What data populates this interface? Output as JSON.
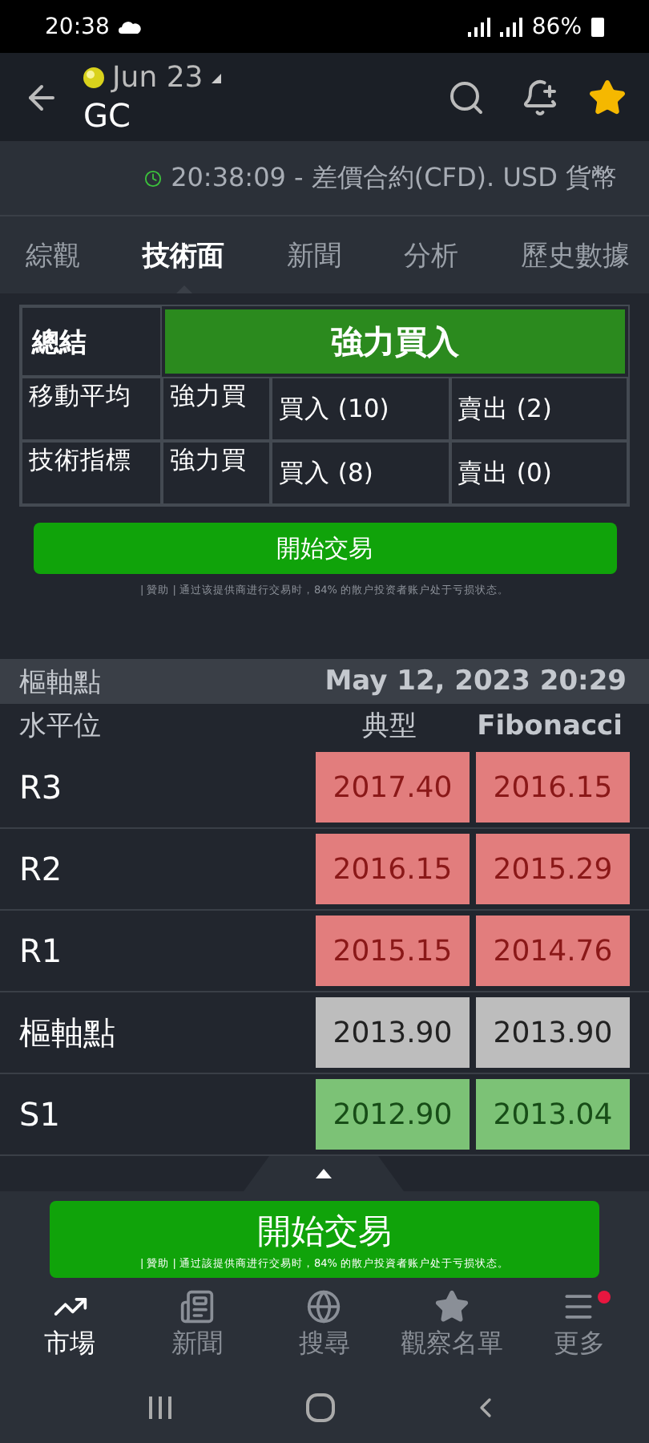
{
  "status_bar": {
    "time": "20:38",
    "battery": "86%"
  },
  "header": {
    "contract": "Jun 23",
    "symbol": "GC",
    "starred": true
  },
  "quote_info": "20:38:09 - 差價合約(CFD). USD 貨幣",
  "tabs": [
    {
      "label": "綜觀",
      "selected": false
    },
    {
      "label": "技術面",
      "selected": true
    },
    {
      "label": "新聞",
      "selected": false
    },
    {
      "label": "分析",
      "selected": false
    },
    {
      "label": "歷史數據",
      "selected": false
    }
  ],
  "summary": {
    "label": "總結",
    "verdict": "強力買入",
    "rows": [
      {
        "name": "移動平均",
        "signal": "強力買",
        "buy": "買入 (10)",
        "sell": "賣出 (2)"
      },
      {
        "name": "技術指標",
        "signal": "強力買",
        "buy": "買入 (8)",
        "sell": "賣出 (0)"
      }
    ]
  },
  "trade_button": {
    "label": "開始交易",
    "disclaimer": "| 贊助 | 通过该提供商进行交易时，84% 的散户投资者账户处于亏损状态。"
  },
  "pivot": {
    "title": "樞軸點",
    "date": "May 12, 2023 20:29",
    "columns": [
      "水平位",
      "典型",
      "Fibonacci"
    ],
    "rows": [
      {
        "level": "R3",
        "kind": "resistance",
        "classic": "2017.40",
        "fibonacci": "2016.15"
      },
      {
        "level": "R2",
        "kind": "resistance",
        "classic": "2016.15",
        "fibonacci": "2015.29"
      },
      {
        "level": "R1",
        "kind": "resistance",
        "classic": "2015.15",
        "fibonacci": "2014.76"
      },
      {
        "level": "樞軸點",
        "kind": "pivot",
        "classic": "2013.90",
        "fibonacci": "2013.90"
      },
      {
        "level": "S1",
        "kind": "support",
        "classic": "2012.90",
        "fibonacci": "2013.04"
      }
    ]
  },
  "bottom_trade": {
    "label": "開始交易",
    "disclaimer": "| 贊助 | 通过該提供商进行交易时，84% 的散户投資者账户处于亏损状态。"
  },
  "nav": [
    {
      "label": "市場",
      "selected": true,
      "badge": false
    },
    {
      "label": "新聞",
      "selected": false,
      "badge": false
    },
    {
      "label": "搜尋",
      "selected": false,
      "badge": false
    },
    {
      "label": "觀察名單",
      "selected": false,
      "badge": false
    },
    {
      "label": "更多",
      "selected": false,
      "badge": true
    }
  ]
}
